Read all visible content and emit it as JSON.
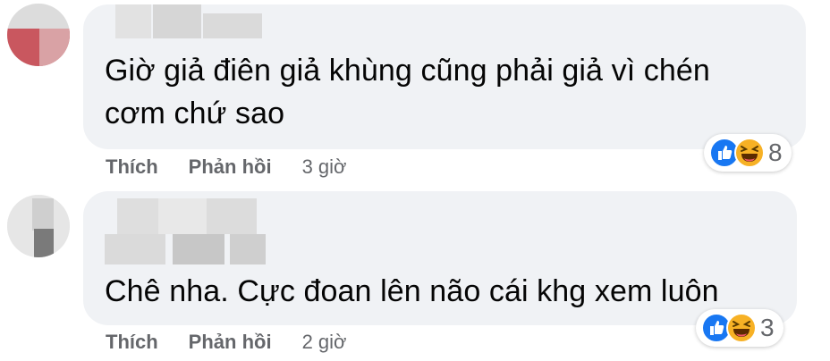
{
  "comments": [
    {
      "text_line1": "Giờ giả điên giả khùng cũng phải giả vì chén",
      "text_line2": "cơm chứ sao",
      "reaction_count": "8",
      "like_label": "Thích",
      "reply_label": "Phản hồi",
      "time": "3 giờ",
      "reactions": [
        "like-icon",
        "haha-icon"
      ]
    },
    {
      "text_line1": "Chê nha. Cực đoan lên não cái khg xem luôn",
      "reaction_count": "3",
      "like_label": "Thích",
      "reply_label": "Phản hồi",
      "time": "2 giờ",
      "reactions": [
        "like-icon",
        "haha-icon"
      ]
    }
  ],
  "colors": {
    "bubble": "#f0f2f5",
    "like_blue": "#1877f2",
    "haha_yellow": "#f7b125",
    "meta_gray": "#65676b"
  }
}
